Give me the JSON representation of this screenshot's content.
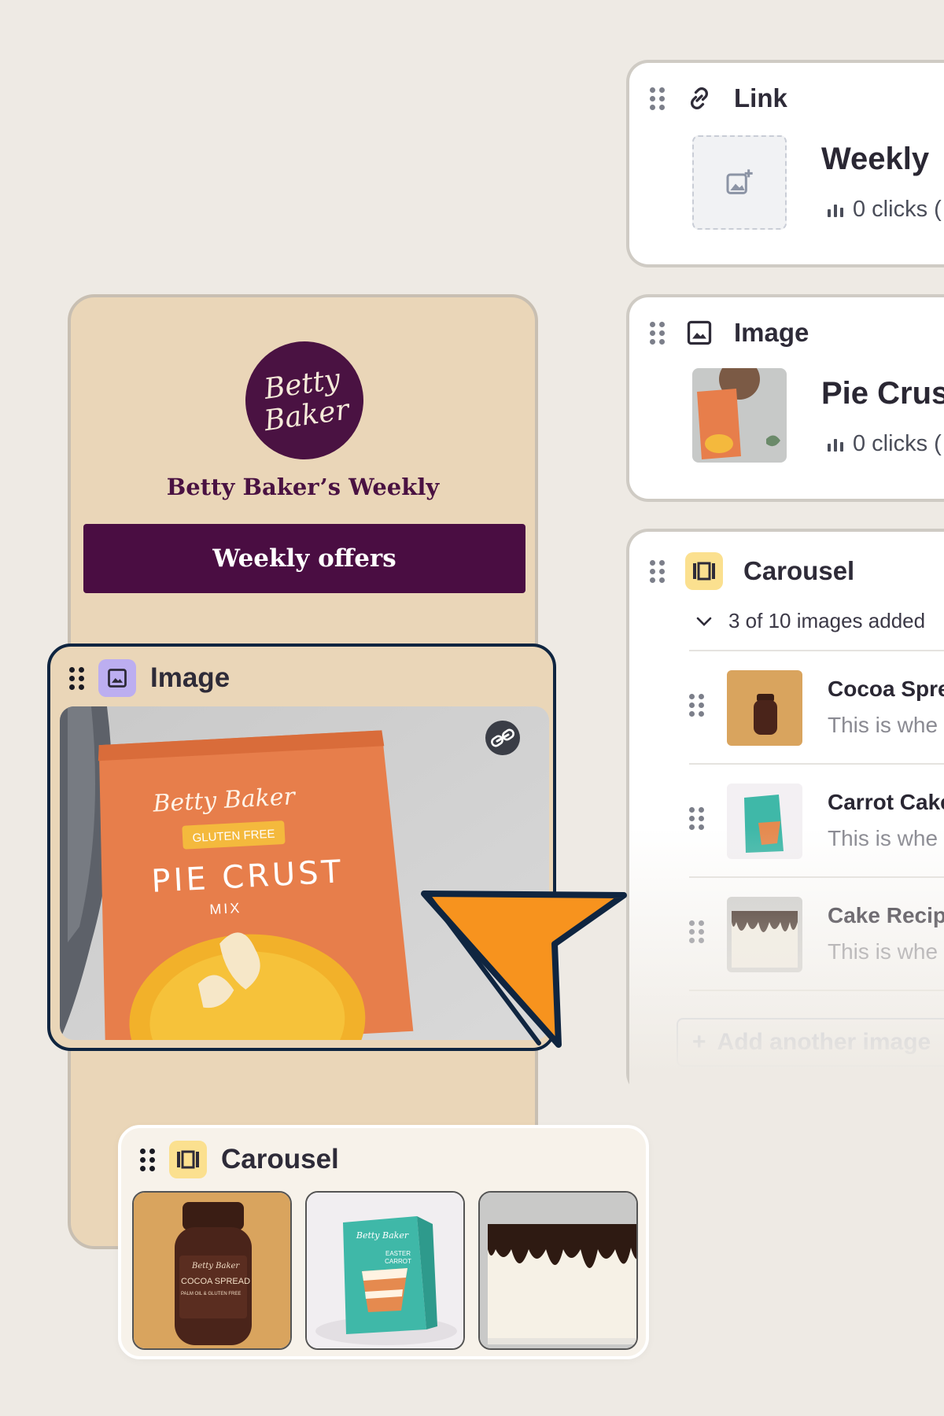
{
  "phone": {
    "logo_line1": "Betty",
    "logo_line2": "Baker",
    "profile_title": "Betty Baker’s Weekly",
    "offers_button": "Weekly offers"
  },
  "image_block": {
    "title": "Image",
    "icon": "image-icon",
    "link_icon": "link-icon",
    "product": {
      "brand": "Betty Baker",
      "badge": "GLUTEN FREE",
      "name": "PIE CRUST",
      "sub": "MIX"
    }
  },
  "carousel_block": {
    "title": "Carousel",
    "icon": "carousel-icon",
    "thumb1_label_brand": "Betty Baker",
    "thumb1_label": "COCOA SPREAD",
    "thumb1_sub": "PALM OIL & GLUTEN FREE",
    "thumb2_brand": "Betty Baker",
    "thumb2_label1": "EASTER",
    "thumb2_label2": "CARROT"
  },
  "link_card": {
    "title": "Link",
    "icon": "link-icon",
    "heading": "Weekly",
    "clicks": "0 clicks ("
  },
  "image_card": {
    "title": "Image",
    "icon": "image-icon",
    "heading": "Pie Crus",
    "clicks": "0 clicks ("
  },
  "carousel_card": {
    "title": "Carousel",
    "icon": "carousel-icon",
    "count": "3 of 10 images added",
    "items": [
      {
        "name": "Cocoa Spre",
        "desc": "This is whe"
      },
      {
        "name": "Carrot Cake",
        "desc": "This is whe"
      },
      {
        "name": "Cake Recip",
        "desc": "This is whe"
      }
    ],
    "add_button": "Add another image"
  },
  "colors": {
    "background": "#eeeae4",
    "phone_bg": "#ead6b8",
    "brand_plum": "#4a0d42",
    "selection_border": "#0f2540",
    "cursor_fill": "#f7931e",
    "badge_purple": "#bcaef0",
    "badge_yellow": "#fbe08f"
  }
}
